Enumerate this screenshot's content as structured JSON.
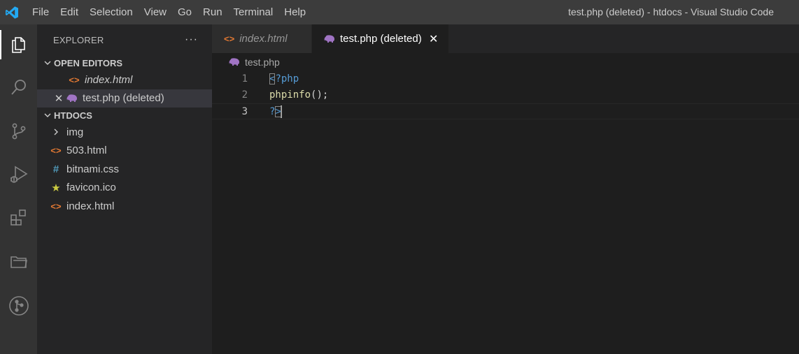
{
  "window": {
    "title": "test.php (deleted) - htdocs - Visual Studio Code",
    "logo_icon": "vscode-logo-icon",
    "accent_color": "#0078d4"
  },
  "menu": {
    "items": [
      "File",
      "Edit",
      "Selection",
      "View",
      "Go",
      "Run",
      "Terminal",
      "Help"
    ]
  },
  "activity_bar": {
    "items": [
      {
        "icon": "explorer-icon",
        "active": true
      },
      {
        "icon": "search-icon",
        "active": false
      },
      {
        "icon": "source-control-icon",
        "active": false
      },
      {
        "icon": "run-debug-icon",
        "active": false
      },
      {
        "icon": "extensions-icon",
        "active": false
      },
      {
        "icon": "folder-icon",
        "active": false
      },
      {
        "icon": "git-graph-icon",
        "active": false
      }
    ]
  },
  "sidebar": {
    "title": "EXPLORER",
    "more": "···",
    "open_editors": {
      "label": "OPEN EDITORS",
      "items": [
        {
          "name": "index.html",
          "icon": "html-icon",
          "italic": true,
          "selected": false
        },
        {
          "name": "test.php (deleted)",
          "icon": "php-icon",
          "italic": false,
          "selected": true
        }
      ]
    },
    "workspace": {
      "label": "HTDOCS",
      "items": [
        {
          "name": "img",
          "icon": "chevron-right-icon"
        },
        {
          "name": "503.html",
          "icon": "html-icon"
        },
        {
          "name": "bitnami.css",
          "icon": "css-hash-icon"
        },
        {
          "name": "favicon.ico",
          "icon": "star-icon"
        },
        {
          "name": "index.html",
          "icon": "html-icon"
        }
      ]
    }
  },
  "tabs": [
    {
      "label": "index.html",
      "icon": "html-icon",
      "active": false,
      "italic": true
    },
    {
      "label": "test.php (deleted)",
      "icon": "php-icon",
      "active": true,
      "italic": false,
      "close": "✕"
    }
  ],
  "breadcrumb": {
    "file": "test.php",
    "icon": "php-icon"
  },
  "editor": {
    "lines": [
      {
        "number": "1",
        "text": "<?php"
      },
      {
        "number": "2",
        "text": "phpinfo();"
      },
      {
        "number": "3",
        "text": "?>"
      }
    ],
    "current_line": "3"
  }
}
